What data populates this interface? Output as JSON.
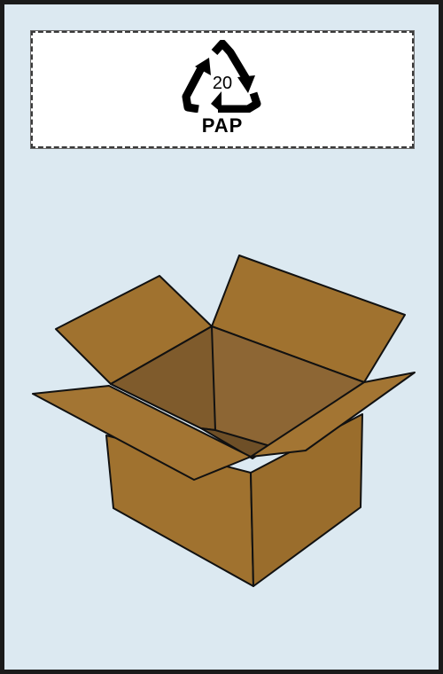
{
  "recycling_label": {
    "code": "20",
    "material": "PAP",
    "icon": "recycling-triangle-icon"
  },
  "illustration": {
    "icon": "open-cardboard-box-icon",
    "colors": {
      "cardboard": "#a0722f",
      "cardboard_inner": "#8a6230",
      "outline": "#111111"
    }
  },
  "colors": {
    "background": "#dce9f1",
    "frame": "#1b1b1b",
    "label_background": "#ffffff"
  }
}
